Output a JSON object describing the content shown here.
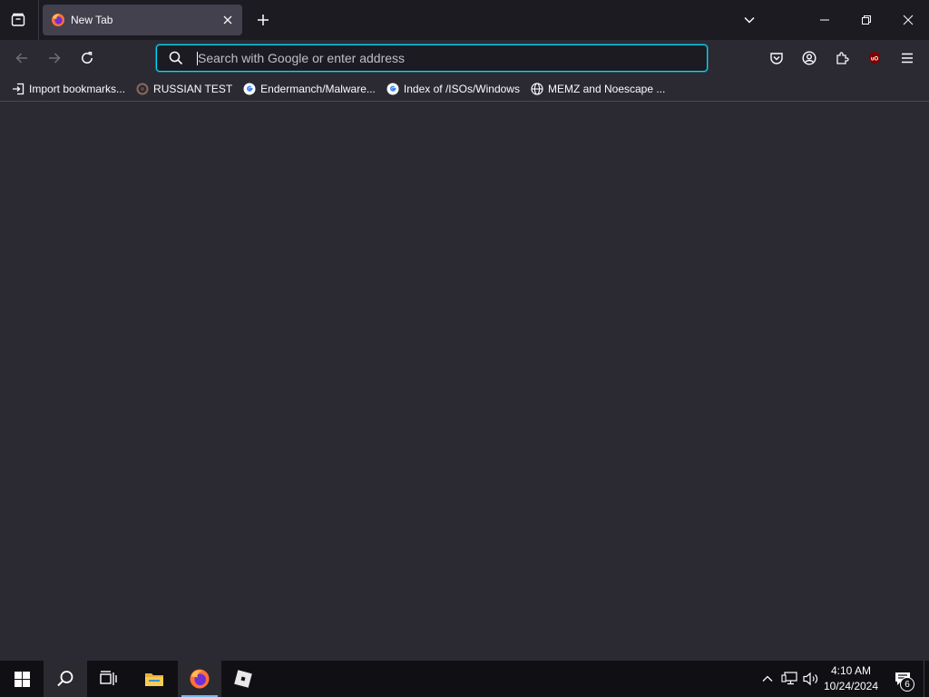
{
  "browser": {
    "tab": {
      "title": "New Tab"
    },
    "urlbar": {
      "placeholder": "Search with Google or enter address",
      "value": ""
    },
    "colors": {
      "accent": "#00ddff",
      "toolbar": "#2b2a33",
      "tabstrip": "#1c1b22"
    }
  },
  "bookmarks": [
    {
      "label": "Import bookmarks...",
      "icon": "import-icon"
    },
    {
      "label": "RUSSIAN TEST",
      "icon": "site-favicon"
    },
    {
      "label": "Endermanch/Malware...",
      "icon": "google-favicon"
    },
    {
      "label": "Index of /ISOs/Windows",
      "icon": "google-favicon"
    },
    {
      "label": "MEMZ and Noescape ...",
      "icon": "globe-icon"
    }
  ],
  "taskbar": {
    "time": "4:10 AM",
    "date": "10/24/2024",
    "notification_count": "6"
  }
}
